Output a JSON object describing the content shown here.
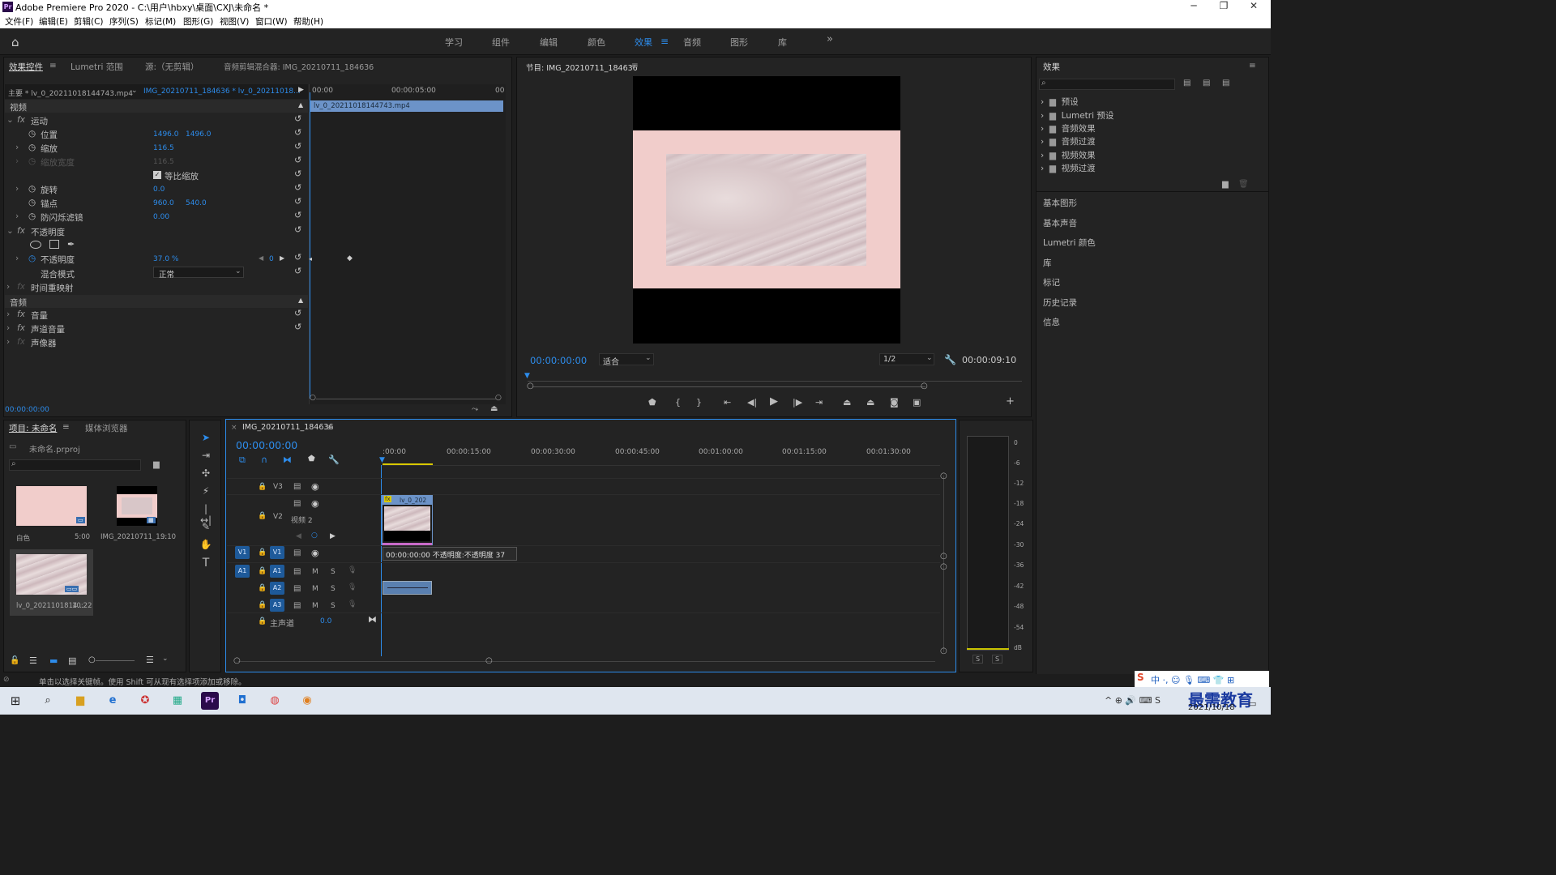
{
  "title_bar": {
    "title": "Adobe Premiere Pro 2020 - C:\\用户\\hbxy\\桌面\\CXJ\\未命名 *",
    "minimize": "─",
    "maximize": "❐",
    "close": "✕"
  },
  "menu": [
    "文件(F)",
    "编辑(E)",
    "剪辑(C)",
    "序列(S)",
    "标记(M)",
    "图形(G)",
    "视图(V)",
    "窗口(W)",
    "帮助(H)"
  ],
  "workspaces": [
    "学习",
    "组件",
    "编辑",
    "颜色",
    "效果",
    "音频",
    "图形",
    "库"
  ],
  "workspace_active": "效果",
  "workspace_more": "»",
  "effect_controls": {
    "tabs": [
      "效果控件",
      "Lumetri 范围",
      "源:（无剪辑）",
      "音频剪辑混合器: IMG_20210711_184636"
    ],
    "master": "主要 * lv_0_20211018144743.mp4",
    "sequence_clip": "IMG_20210711_184636 * lv_0_20211018...",
    "ruler": [
      "00:00",
      "00:00:05:00",
      "00"
    ],
    "clip_bar": "lv_0_20211018144743.mp4",
    "video_header": "视频",
    "motion": "运动",
    "position": {
      "label": "位置",
      "x": "1496.0",
      "y": "1496.0"
    },
    "scale": {
      "label": "缩放",
      "value": "116.5"
    },
    "scale_width": {
      "label": "缩放宽度",
      "value": "116.5"
    },
    "uniform_scale": "等比缩放",
    "rotation": {
      "label": "旋转",
      "value": "0.0"
    },
    "anchor": {
      "label": "锚点",
      "x": "960.0",
      "y": "540.0"
    },
    "flicker": {
      "label": "防闪烁滤镜",
      "value": "0.00"
    },
    "opacity_group": "不透明度",
    "opacity": {
      "label": "不透明度",
      "value": "37.0 %",
      "keyframe": "0"
    },
    "blend": {
      "label": "混合模式",
      "value": "正常"
    },
    "time_remap": "时间重映射",
    "audio_header": "音频",
    "volume": "音量",
    "channel_volume": "声道音量",
    "panner": "声像器",
    "timecode": "00:00:00:00"
  },
  "program": {
    "title": "节目: IMG_20210711_184636",
    "timecode": "00:00:00:00",
    "fit": "适合",
    "quality": "1/2",
    "duration": "00:00:09:10"
  },
  "effects_panel": {
    "title": "效果",
    "items": [
      "预设",
      "Lumetri 预设",
      "音频效果",
      "音频过渡",
      "视频效果",
      "视频过渡"
    ],
    "sections": [
      "基本图形",
      "基本声音",
      "Lumetri 颜色",
      "库",
      "标记",
      "历史记录",
      "信息"
    ]
  },
  "project": {
    "tabs": [
      "项目: 未命名",
      "媒体浏览器"
    ],
    "file": "未命名.prproj",
    "items": [
      {
        "name": "白色",
        "duration": "5:00"
      },
      {
        "name": "IMG_20210711_1...",
        "duration": "9:10"
      },
      {
        "name": "lv_0_2021101814...",
        "duration": "10:22"
      }
    ]
  },
  "timeline": {
    "tab": "IMG_20210711_184636",
    "timecode": "00:00:00:00",
    "ruler": [
      ":00:00",
      "00:00:15:00",
      "00:00:30:00",
      "00:00:45:00",
      "00:01:00:00",
      "00:01:15:00",
      "00:01:30:00"
    ],
    "tracks": {
      "v3": "V3",
      "v2": "V2",
      "v2_name": "视频 2",
      "v1": "V1",
      "a1": "A1",
      "a2": "A2",
      "a3": "A3",
      "master": "主声道",
      "master_value": "0.0",
      "m": "M",
      "s": "S"
    },
    "clip_label": "lv_0_202",
    "tooltip": "00:00:00:00  不透明度:不透明度  37"
  },
  "meter": {
    "scale": [
      "0",
      "-6",
      "-12",
      "-18",
      "-24",
      "-30",
      "-36",
      "-42",
      "-48",
      "-54",
      "dB"
    ],
    "solo": [
      "S",
      "S"
    ]
  },
  "status": "单击以选择关键帧。使用 Shift 可从现有选择项添加或移除。",
  "taskbar": {
    "date": "2021/10/18",
    "watermark": "最需教育"
  },
  "colors": {
    "accent": "#2d8ceb",
    "pink": "#f1cdcb",
    "clip_blue": "#6c93c8"
  }
}
